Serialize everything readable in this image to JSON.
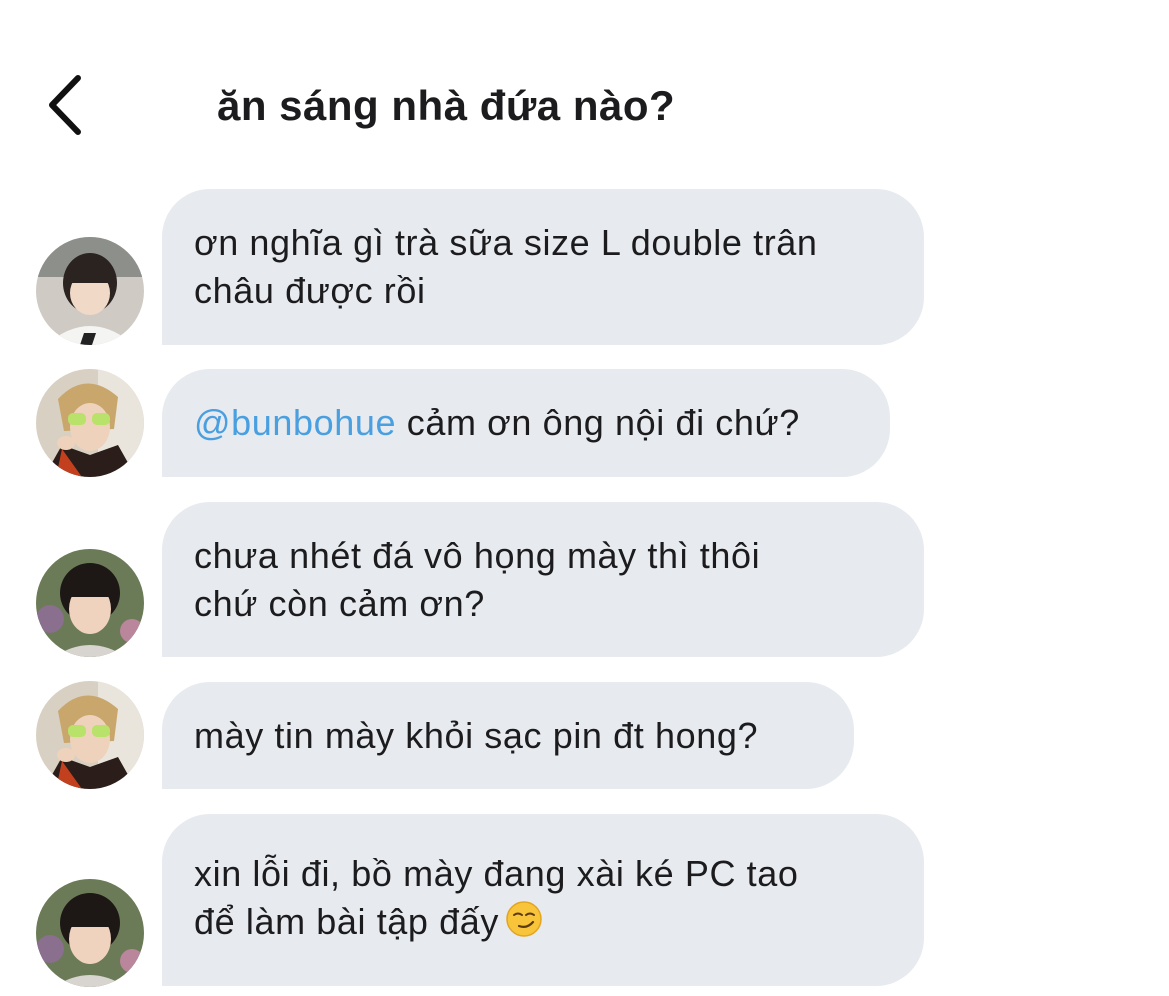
{
  "header": {
    "title": "ăn sáng nhà đứa nào?",
    "back_icon": "chevron-left-icon"
  },
  "colors": {
    "bubble": "#e7eaee",
    "mention": "#4a9fe0",
    "text": "#1c1c1e"
  },
  "messages": [
    {
      "avatar": "user-a-avatar",
      "line1": "ơn nghĩa gì trà sữa size L double trân",
      "line2": "châu được rồi"
    },
    {
      "avatar": "user-b-avatar",
      "mention": "@bunbohue",
      "text": " cảm ơn ông nội đi chứ?"
    },
    {
      "avatar": "user-c-avatar",
      "line1": "chưa nhét đá vô họng mày thì thôi",
      "line2": "chứ còn cảm ơn?"
    },
    {
      "avatar": "user-b-avatar",
      "line1": "mày tin mày khỏi sạc pin đt hong?"
    },
    {
      "avatar": "user-c-avatar",
      "line1": "xin lỗi đi, bồ mày đang xài ké PC tao",
      "line2": "để làm bài tập đấy",
      "emoji": "smirk-emoji"
    }
  ]
}
